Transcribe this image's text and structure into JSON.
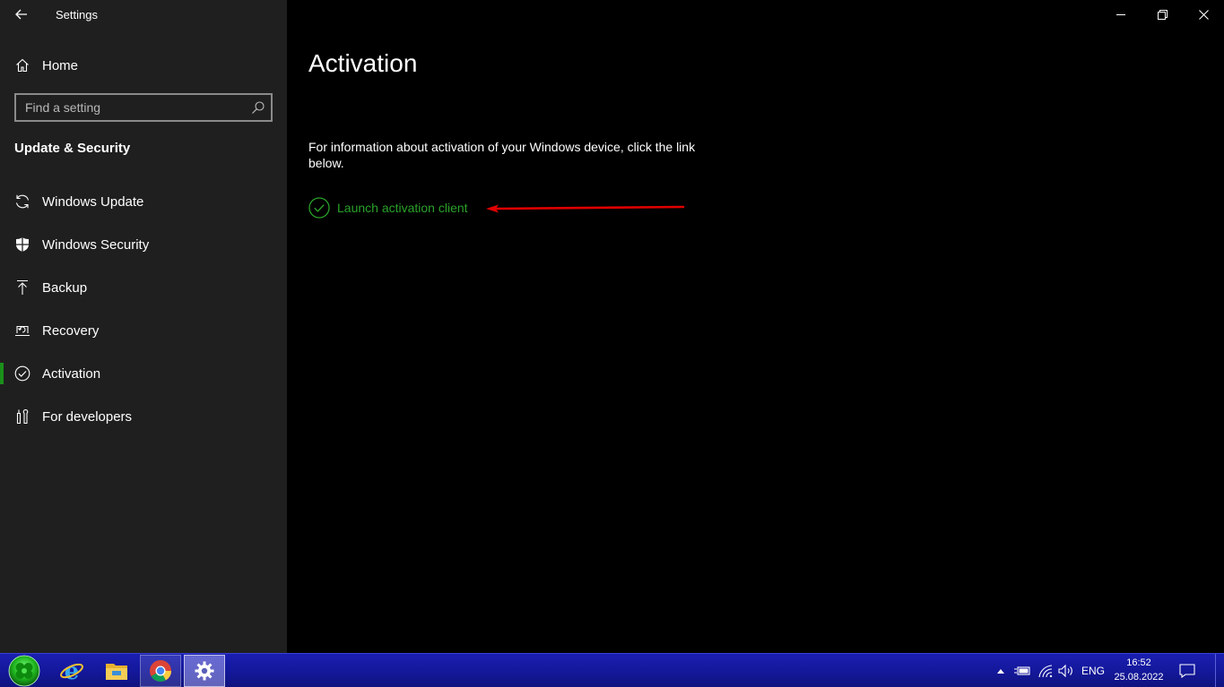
{
  "window": {
    "title": "Settings",
    "controls": [
      "minimize",
      "restore",
      "close"
    ]
  },
  "sidebar": {
    "home_label": "Home",
    "search_placeholder": "Find a setting",
    "section_title": "Update & Security",
    "items": [
      {
        "label": "Windows Update",
        "icon": "sync-icon"
      },
      {
        "label": "Windows Security",
        "icon": "shield-icon"
      },
      {
        "label": "Backup",
        "icon": "upload-arrow-icon"
      },
      {
        "label": "Recovery",
        "icon": "recovery-icon"
      },
      {
        "label": "Activation",
        "icon": "check-circle-icon",
        "active": true
      },
      {
        "label": "For developers",
        "icon": "developer-tools-icon"
      }
    ]
  },
  "main": {
    "title": "Activation",
    "info": "For information about activation of your Windows device, click the link below.",
    "link_label": "Launch activation client",
    "accent_color": "#2aa12a",
    "annotation_color": "#e00000"
  },
  "taskbar": {
    "apps": [
      "start-orb",
      "internet-explorer",
      "file-explorer",
      "chrome",
      "settings"
    ],
    "tray": {
      "language": "ENG",
      "time": "16:52",
      "date": "25.08.2022"
    }
  }
}
